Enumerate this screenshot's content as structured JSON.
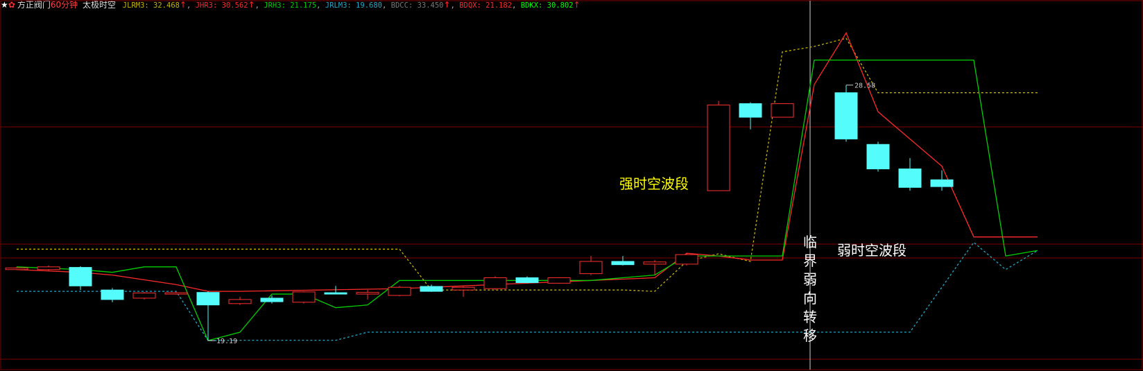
{
  "header": {
    "star_icon": "★",
    "gear_icon": "✿",
    "stock_name": "方正阀门",
    "period": "60分钟",
    "indicator_name": "太极时空",
    "up_arrow": "↑",
    "indicators": [
      {
        "label": "JLRM3",
        "value": "32.468",
        "color": "#c8b400",
        "arrow": true
      },
      {
        "label": "JHR3",
        "value": "30.562",
        "color": "#ff2a2a",
        "arrow": true
      },
      {
        "label": "JRH3",
        "value": "21.175",
        "color": "#00d000",
        "arrow": false
      },
      {
        "label": "JRLM3",
        "value": "19.680",
        "color": "#22a8c8",
        "arrow": false
      },
      {
        "label": "BDCC",
        "value": "33.450",
        "color": "#777777",
        "arrow": true
      },
      {
        "label": "BDQX",
        "value": "21.182",
        "color": "#ff2a2a",
        "arrow": false
      },
      {
        "label": "BDKX",
        "value": "30.802",
        "color": "#00ff00",
        "arrow": true
      }
    ]
  },
  "chart_data": {
    "type": "candlestick",
    "ylim": [
      18.2,
      31.3
    ],
    "candles": [
      {
        "o": 21.8,
        "h": 21.9,
        "l": 21.78,
        "c": 21.86
      },
      {
        "o": 21.8,
        "h": 21.95,
        "l": 21.75,
        "c": 21.9
      },
      {
        "o": 21.88,
        "h": 21.92,
        "l": 21.05,
        "c": 21.2
      },
      {
        "o": 21.05,
        "h": 21.12,
        "l": 20.6,
        "c": 20.7
      },
      {
        "o": 20.75,
        "h": 20.98,
        "l": 20.7,
        "c": 20.94
      },
      {
        "o": 20.92,
        "h": 21.0,
        "l": 20.88,
        "c": 20.95
      },
      {
        "o": 20.96,
        "h": 21.0,
        "l": 19.19,
        "c": 20.5
      },
      {
        "o": 20.55,
        "h": 20.8,
        "l": 20.5,
        "c": 20.7
      },
      {
        "o": 20.75,
        "h": 20.85,
        "l": 20.55,
        "c": 20.62
      },
      {
        "o": 20.6,
        "h": 21.0,
        "l": 20.55,
        "c": 20.98
      },
      {
        "o": 20.95,
        "h": 21.2,
        "l": 20.9,
        "c": 20.92
      },
      {
        "o": 20.9,
        "h": 21.05,
        "l": 20.7,
        "c": 20.96
      },
      {
        "o": 20.85,
        "h": 21.2,
        "l": 20.82,
        "c": 21.15
      },
      {
        "o": 21.18,
        "h": 21.25,
        "l": 20.98,
        "c": 21.0
      },
      {
        "o": 21.05,
        "h": 21.2,
        "l": 20.8,
        "c": 21.15
      },
      {
        "o": 21.1,
        "h": 21.55,
        "l": 21.05,
        "c": 21.5
      },
      {
        "o": 21.5,
        "h": 21.55,
        "l": 21.3,
        "c": 21.32
      },
      {
        "o": 21.3,
        "h": 21.52,
        "l": 21.28,
        "c": 21.5
      },
      {
        "o": 21.65,
        "h": 22.3,
        "l": 21.6,
        "c": 22.1
      },
      {
        "o": 22.1,
        "h": 22.3,
        "l": 21.95,
        "c": 21.98
      },
      {
        "o": 22.0,
        "h": 22.15,
        "l": 21.6,
        "c": 22.08
      },
      {
        "o": 22.0,
        "h": 22.4,
        "l": 21.95,
        "c": 22.35
      },
      {
        "o": 24.7,
        "h": 28.0,
        "l": 24.7,
        "c": 27.85
      },
      {
        "o": 27.9,
        "h": 27.95,
        "l": 26.95,
        "c": 27.4
      },
      {
        "o": 27.4,
        "h": 27.9,
        "l": 27.4,
        "c": 27.9
      },
      {
        "o": 28.3,
        "h": 28.58,
        "l": 26.5,
        "c": 26.6
      },
      {
        "o": 26.4,
        "h": 26.5,
        "l": 25.4,
        "c": 25.5
      },
      {
        "o": 25.5,
        "h": 25.9,
        "l": 24.7,
        "c": 24.82
      },
      {
        "o": 25.1,
        "h": 25.45,
        "l": 24.7,
        "c": 24.85
      }
    ],
    "candle_x": [
      0,
      1,
      2,
      3,
      4,
      5,
      6,
      7,
      8,
      9,
      10,
      11,
      12,
      13,
      14,
      15,
      16,
      17,
      18,
      19,
      20,
      21,
      22,
      23,
      24,
      26,
      27,
      28,
      29
    ],
    "lines": [
      {
        "id": "yellow-dashed",
        "color": "#c8b400",
        "style": "dashed",
        "points": [
          [
            0,
            22.55
          ],
          [
            12,
            22.55
          ],
          [
            13,
            21.05
          ],
          [
            19,
            21.05
          ],
          [
            20,
            21.0
          ],
          [
            21,
            22.1
          ],
          [
            22,
            22.38
          ],
          [
            23,
            22.1
          ],
          [
            24,
            29.8
          ],
          [
            25,
            30.0
          ],
          [
            26,
            30.3
          ],
          [
            27,
            28.3
          ],
          [
            28,
            28.3
          ],
          [
            30,
            28.3
          ],
          [
            31,
            28.3
          ],
          [
            32,
            28.3
          ]
        ]
      },
      {
        "id": "cyan-dashed",
        "color": "#22a8c8",
        "style": "dashed",
        "points": [
          [
            0,
            21.0
          ],
          [
            5,
            21.0
          ],
          [
            6,
            19.19
          ],
          [
            7,
            19.2
          ],
          [
            10,
            19.2
          ],
          [
            11,
            19.5
          ],
          [
            28,
            19.5
          ],
          [
            30,
            22.8
          ],
          [
            31,
            21.8
          ],
          [
            32,
            22.5
          ]
        ]
      },
      {
        "id": "red-solid",
        "color": "#ff2a2a",
        "style": "solid",
        "points": [
          [
            0,
            21.8
          ],
          [
            2,
            21.7
          ],
          [
            3,
            21.6
          ],
          [
            5,
            21.25
          ],
          [
            6,
            21.0
          ],
          [
            7,
            21.0
          ],
          [
            12,
            21.1
          ],
          [
            18,
            21.4
          ],
          [
            20,
            21.5
          ],
          [
            21,
            22.4
          ],
          [
            22,
            22.3
          ],
          [
            23,
            22.15
          ],
          [
            24,
            22.15
          ],
          [
            25,
            28.6
          ],
          [
            26,
            30.5
          ],
          [
            27,
            27.6
          ],
          [
            29,
            25.6
          ],
          [
            30,
            23.0
          ],
          [
            32,
            23.0
          ]
        ]
      },
      {
        "id": "green-solid",
        "color": "#00d000",
        "style": "solid",
        "points": [
          [
            0,
            21.9
          ],
          [
            2,
            21.8
          ],
          [
            3,
            21.7
          ],
          [
            4,
            21.9
          ],
          [
            5,
            21.9
          ],
          [
            6,
            19.19
          ],
          [
            7,
            19.5
          ],
          [
            8,
            20.9
          ],
          [
            9,
            20.9
          ],
          [
            10,
            20.4
          ],
          [
            11,
            20.5
          ],
          [
            12,
            21.4
          ],
          [
            17,
            21.4
          ],
          [
            18,
            21.4
          ],
          [
            19,
            21.5
          ],
          [
            20,
            21.6
          ],
          [
            21,
            22.3
          ],
          [
            22,
            22.3
          ],
          [
            24,
            22.3
          ],
          [
            25,
            29.5
          ],
          [
            30,
            29.5
          ],
          [
            31,
            22.3
          ],
          [
            32,
            22.5
          ]
        ]
      }
    ],
    "labels": {
      "low": "19.19",
      "high": "28.58",
      "strong": "强时空波段",
      "weak": "弱时空波段",
      "critical": "临界弱向转移"
    }
  }
}
